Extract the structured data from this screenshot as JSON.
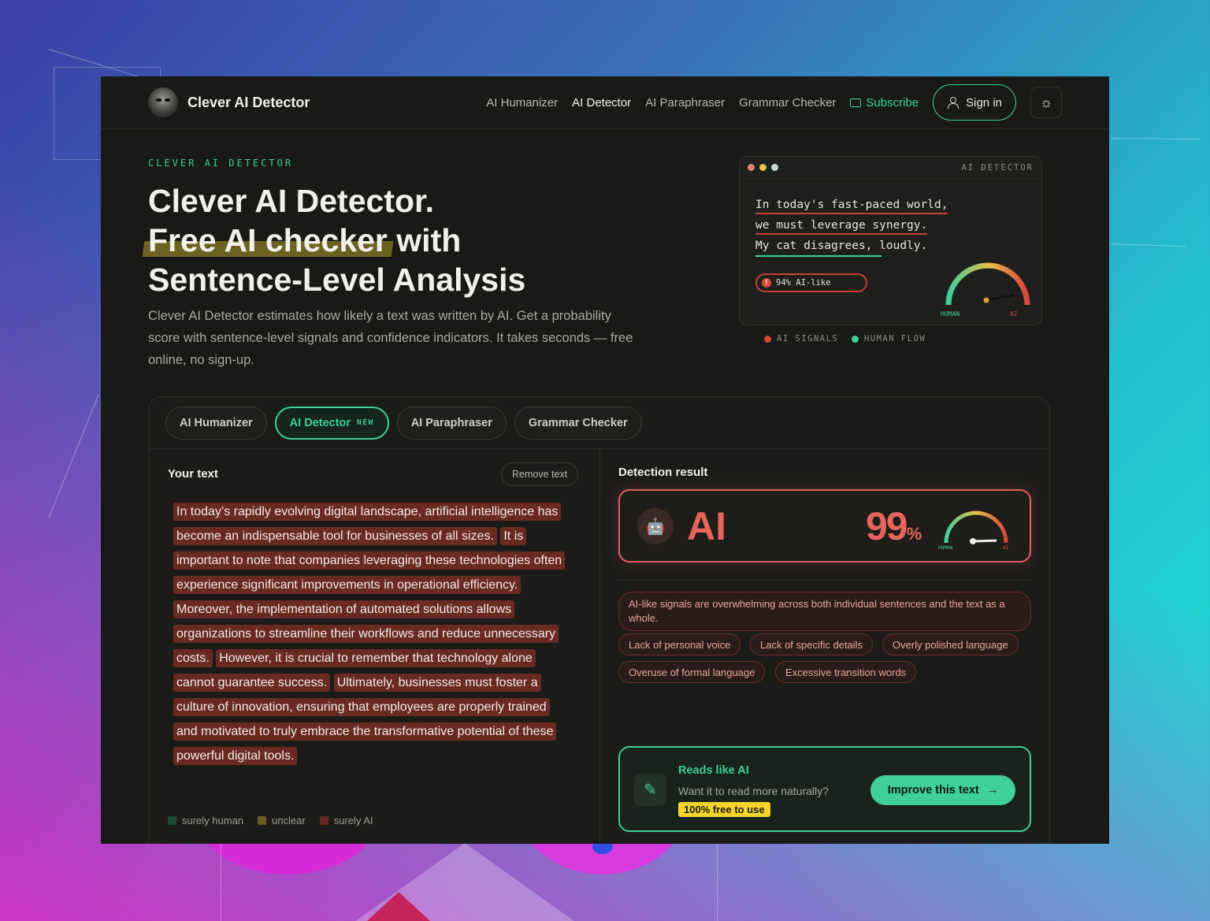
{
  "brand": {
    "name": "Clever AI Detector"
  },
  "nav": {
    "links": [
      "AI Humanizer",
      "AI Detector",
      "AI Paraphraser",
      "Grammar Checker"
    ],
    "subscribe": "Subscribe",
    "signin": "Sign in"
  },
  "hero": {
    "eyebrow": "CLEVER AI DETECTOR",
    "title_line1": "Clever AI Detector.",
    "title_line2_highlight": "Free AI checker",
    "title_line2_rest": " with",
    "title_line3": "Sentence-Level Analysis",
    "description": "Clever AI Detector estimates how likely a text was written by AI. Get a probability score with sentence-level signals and confidence indicators. It takes seconds — free online, no sign-up."
  },
  "demo": {
    "label": "AI DETECTOR",
    "lines": [
      "In today's fast-paced world,",
      "we must leverage synergy.",
      "My cat disagrees, loudly."
    ],
    "pill": "94% AI-like",
    "gauge_left": "HUMAN",
    "gauge_right": "AI",
    "gauge_value": 0.94,
    "legend_ai": "AI SIGNALS",
    "legend_human": "HUMAN FLOW"
  },
  "tabs": [
    {
      "label": "AI Humanizer",
      "badge": ""
    },
    {
      "label": "AI Detector",
      "badge": "NEW"
    },
    {
      "label": "AI Paraphraser",
      "badge": ""
    },
    {
      "label": "Grammar Checker",
      "badge": ""
    }
  ],
  "input": {
    "title": "Your text",
    "remove": "Remove text",
    "sentences": [
      "In today’s rapidly evolving digital landscape, artificial intelligence has become an indispensable tool for businesses of all sizes.",
      "It is important to note that companies leveraging these technologies often experience significant improvements in operational efficiency.",
      "Moreover, the implementation of automated solutions allows organizations to streamline their workflows and reduce unnecessary costs.",
      "However, it is crucial to remember that technology alone cannot guarantee success.",
      "Ultimately, businesses must foster a culture of innovation, ensuring that employees are properly trained and motivated to truly embrace the transformative potential of these powerful digital tools."
    ],
    "legend": [
      "surely human",
      "unclear",
      "surely AI"
    ]
  },
  "result": {
    "title": "Detection result",
    "verdict": "AI",
    "score": "99",
    "score_unit": "%",
    "gauge_left": "HUMAN",
    "gauge_right": "AI",
    "gauge_value": 0.99,
    "summary": "AI-like signals are overwhelming across both individual sentences and the text as a whole.",
    "chips": [
      "Lack of personal voice",
      "Lack of specific details",
      "Overly polished language",
      "Overuse of formal language",
      "Excessive transition words"
    ]
  },
  "cta": {
    "title": "Reads like AI",
    "subtitle": "Want it to read more naturally?",
    "badge": "100% free to use",
    "button": "Improve this text"
  },
  "colors": {
    "accent": "#3ecf9a",
    "ai": "#e5645c",
    "sentence_ai": "#6a2a22",
    "badge": "#f4d42b"
  }
}
